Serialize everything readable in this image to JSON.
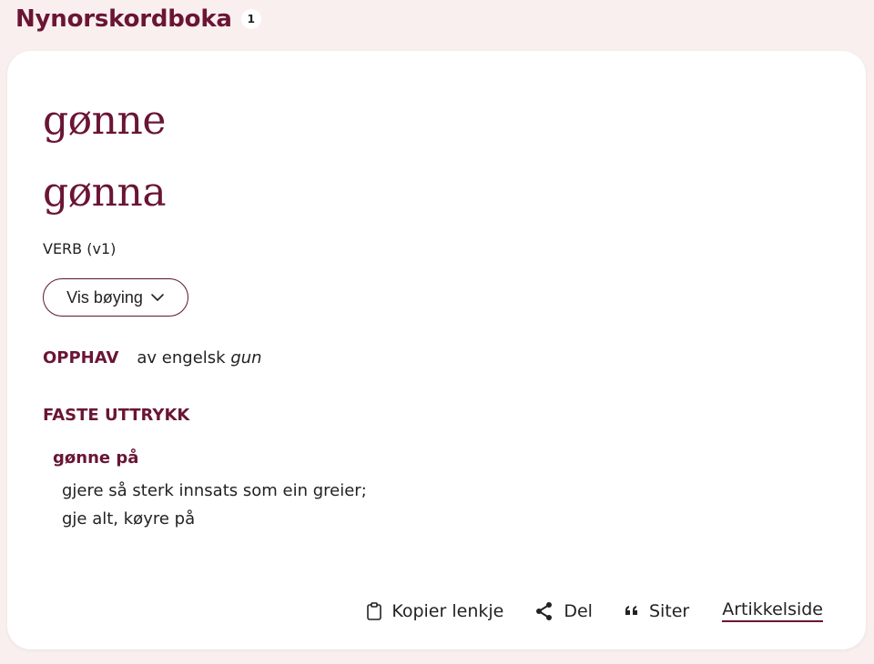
{
  "header": {
    "title": "Nynorskordboka",
    "count": "1"
  },
  "article": {
    "lemmas": [
      "gønne",
      "gønna"
    ],
    "pos": "VERB (v1)",
    "inflection_button": "Vis bøying",
    "origin": {
      "label": "OPPHAV",
      "prefix": "av engelsk ",
      "word": "gun"
    },
    "fixed_expressions": {
      "label": "FASTE UTTRYKK",
      "items": [
        {
          "term": "gønne på",
          "definition_lines": [
            "gjere så sterk innsats som ein greier;",
            "gje alt, køyre på"
          ]
        }
      ]
    }
  },
  "actions": {
    "copy_link": "Kopier lenkje",
    "share": "Del",
    "cite": "Siter",
    "article_page": "Artikkelside"
  },
  "icons": [
    "clipboard-icon",
    "share-icon",
    "quote-icon",
    "chevron-down-icon"
  ],
  "colors": {
    "accent": "#6a1535",
    "background": "#f9efee",
    "card": "#ffffff"
  }
}
